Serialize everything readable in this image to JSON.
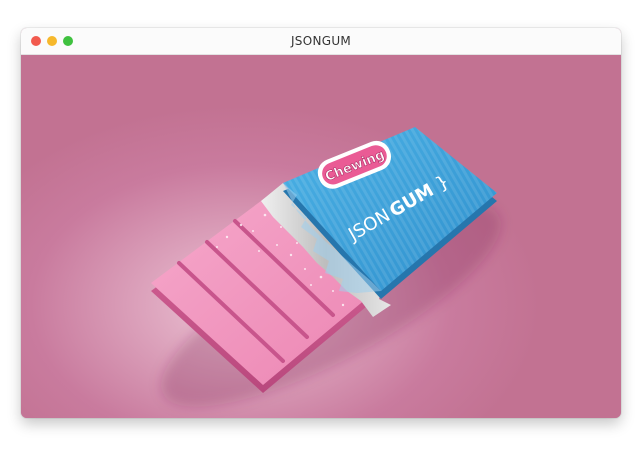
{
  "window": {
    "title": "JSONGUM"
  },
  "artwork": {
    "badge_text": "Chewing",
    "brand_prefix": "JSON",
    "brand_suffix": "GUM",
    "brand_brace": "}",
    "colors": {
      "background": "#c4779a",
      "gum": "#ef8ab7",
      "wrapper": "#3ea3dc",
      "foil": "#c9c9c9",
      "badge": "#ea5b95"
    }
  }
}
